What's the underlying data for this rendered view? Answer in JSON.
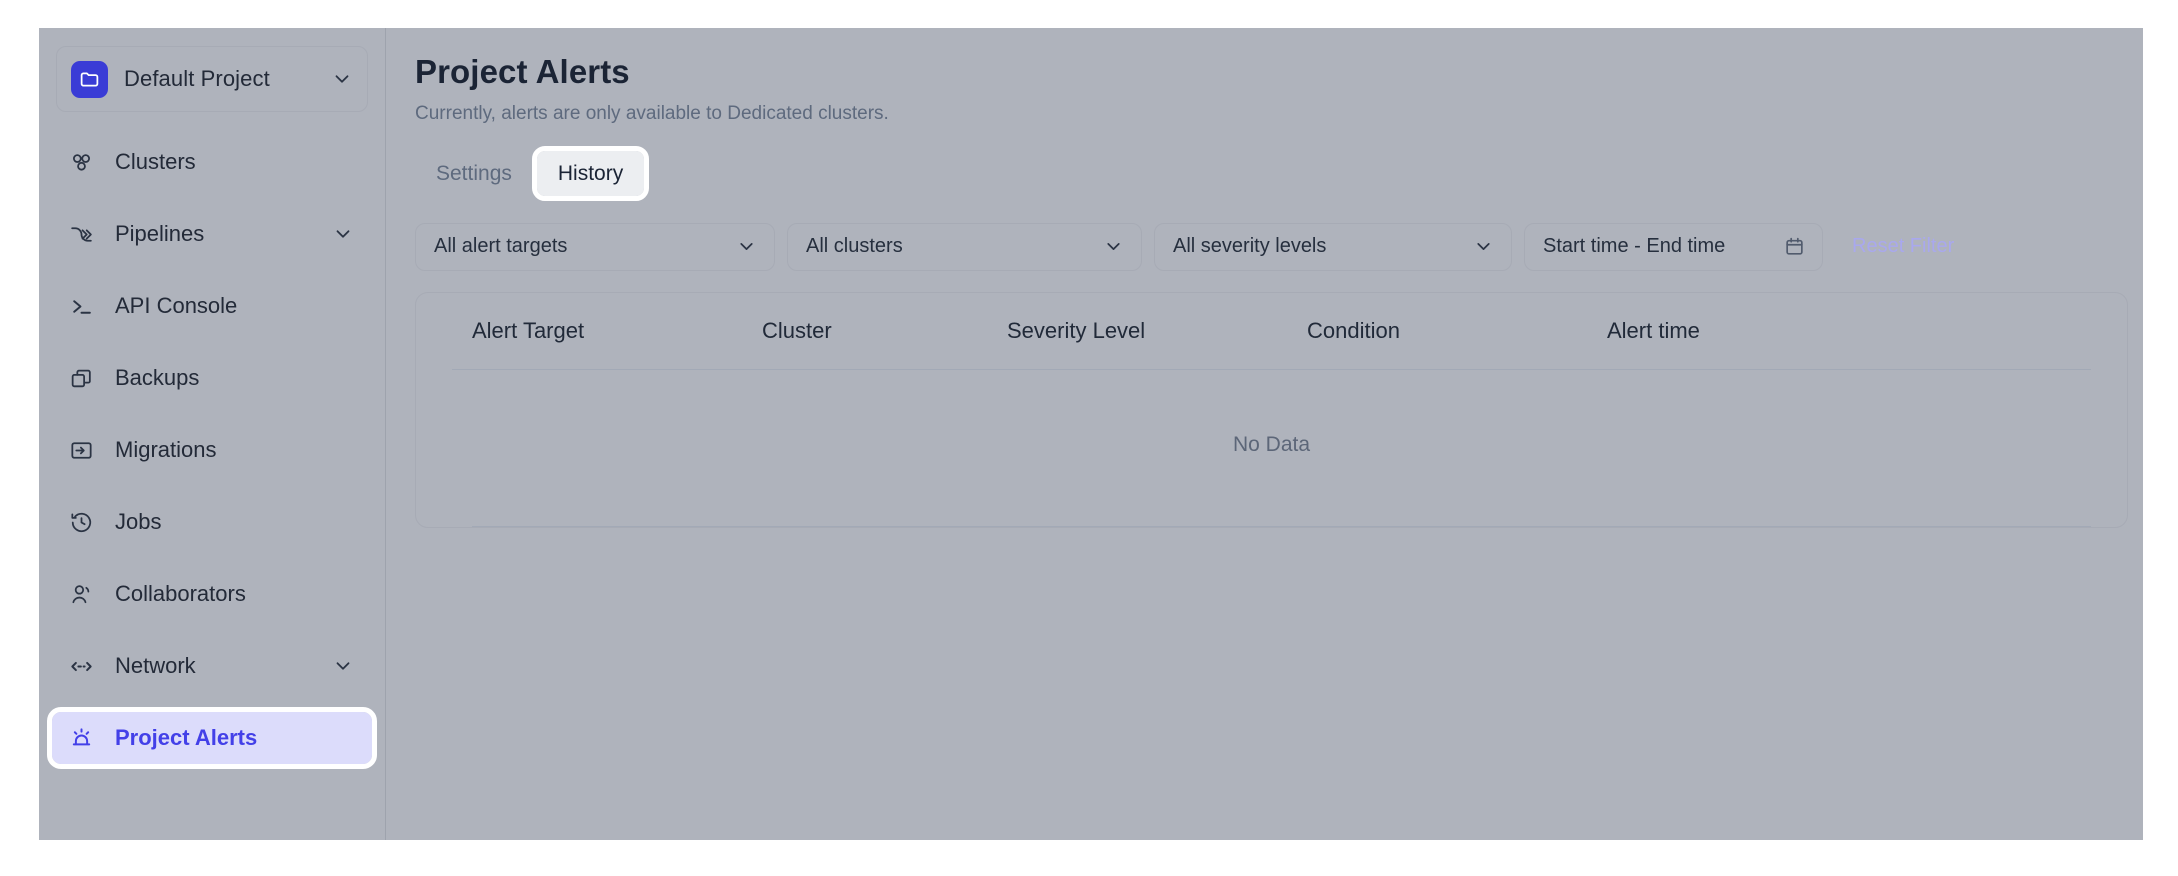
{
  "sidebar": {
    "project_switcher": {
      "name": "Default Project",
      "icon": "folder-icon",
      "chevron": "chevron-down-icon"
    },
    "items": [
      {
        "label": "Clusters",
        "icon": "clusters-icon",
        "expandable": false,
        "active": false
      },
      {
        "label": "Pipelines",
        "icon": "pipelines-icon",
        "expandable": true,
        "active": false
      },
      {
        "label": "API Console",
        "icon": "terminal-icon",
        "expandable": false,
        "active": false
      },
      {
        "label": "Backups",
        "icon": "copy-icon",
        "expandable": false,
        "active": false
      },
      {
        "label": "Migrations",
        "icon": "migrations-icon",
        "expandable": false,
        "active": false
      },
      {
        "label": "Jobs",
        "icon": "history-clock-icon",
        "expandable": false,
        "active": false
      },
      {
        "label": "Collaborators",
        "icon": "user-icon",
        "expandable": false,
        "active": false
      },
      {
        "label": "Network",
        "icon": "network-icon",
        "expandable": true,
        "active": false
      },
      {
        "label": "Project Alerts",
        "icon": "siren-alert-icon",
        "expandable": false,
        "active": true
      }
    ]
  },
  "header": {
    "title": "Project Alerts",
    "subtitle": "Currently, alerts are only available to Dedicated clusters."
  },
  "tabs": [
    {
      "label": "Settings",
      "active": false
    },
    {
      "label": "History",
      "active": true
    }
  ],
  "filters": {
    "alert_target": {
      "value": "All alert targets",
      "chevron": "chevron-down-icon"
    },
    "cluster": {
      "value": "All clusters",
      "chevron": "chevron-down-icon"
    },
    "severity": {
      "value": "All severity levels",
      "chevron": "chevron-down-icon"
    },
    "date_range": {
      "value": "Start time - End time",
      "icon": "calendar-icon"
    },
    "reset_label": "Reset Filter"
  },
  "table": {
    "columns": [
      "Alert Target",
      "Cluster",
      "Severity Level",
      "Condition",
      "Alert time"
    ],
    "rows": [],
    "empty_text": "No Data"
  },
  "colors": {
    "accent": "#4340e8",
    "accent_soft": "#dcdcfb",
    "brand_badge": "#3a3cd6",
    "page_bg": "#afb3bc",
    "text": "#1b2435",
    "muted": "#5e6a7e",
    "reset_disabled": "#a9a8ee"
  }
}
